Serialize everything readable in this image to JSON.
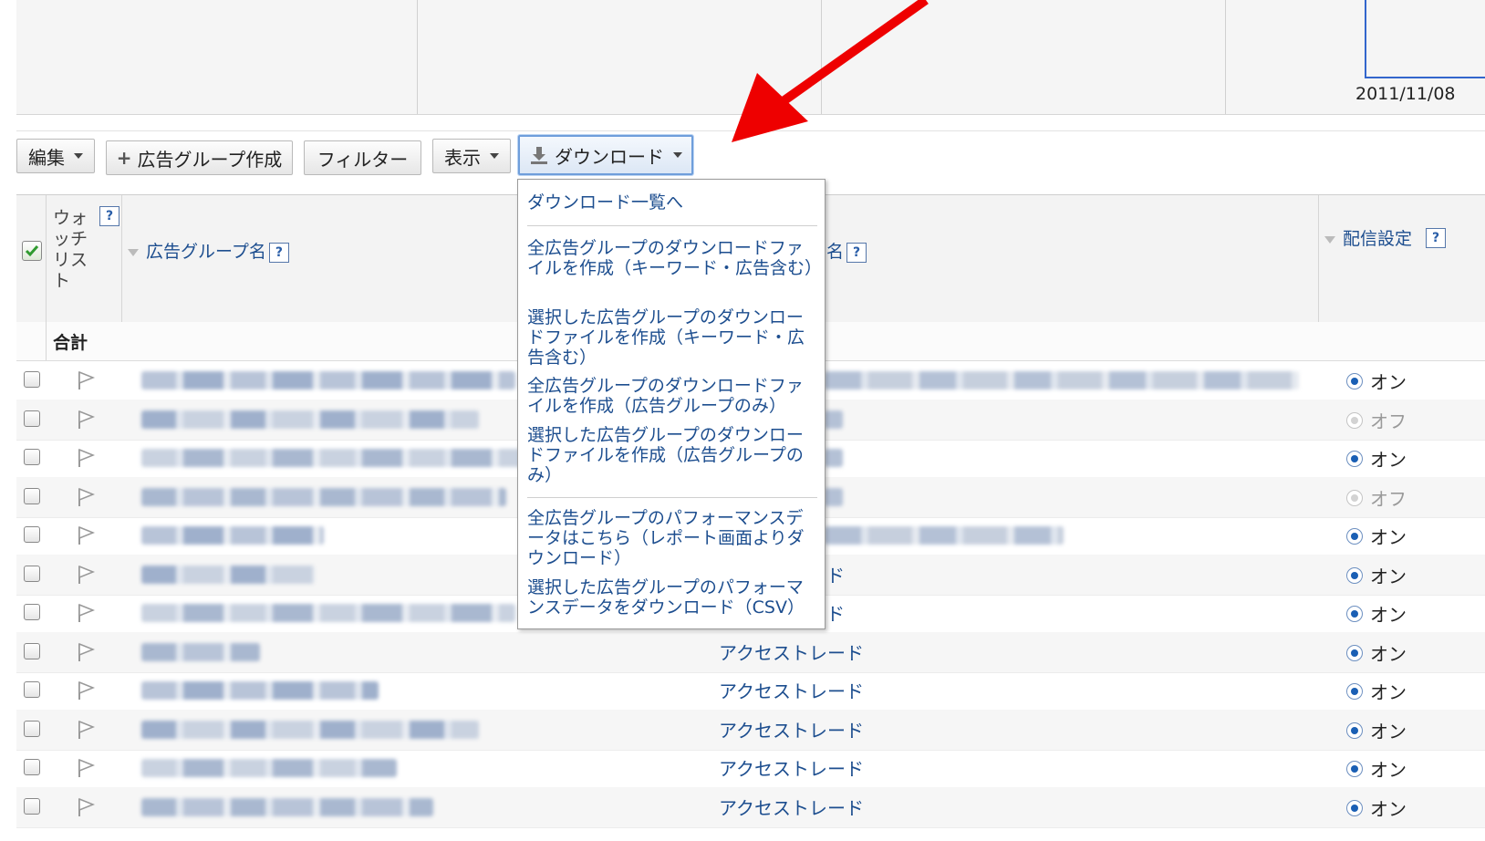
{
  "chart": {
    "date_label": "2011/11/08"
  },
  "toolbar": {
    "edit_label": "編集",
    "create_group_label": "広告グループ作成",
    "filter_label": "フィルター",
    "display_label": "表示",
    "download_label": "ダウンロード"
  },
  "download_menu": {
    "items": [
      "ダウンロード一覧へ",
      "全広告グループのダウンロードファイルを作成（キーワード・広告含む）",
      "選択した広告グループのダウンロードファイルを作成（キーワード・広告含む）",
      "全広告グループのダウンロードファイルを作成（広告グループのみ）",
      "選択した広告グループのダウンロードファイルを作成（広告グループのみ）",
      "全広告グループのパフォーマンスデータはこちら（レポート画面よりダウンロード）",
      "選択した広告グループのパフォーマンスデータをダウンロード（CSV）"
    ]
  },
  "table": {
    "headers": {
      "watchlist": "ウォッチリスト",
      "ad_group_name": "広告グループ名",
      "campaign_name_suffix": "名",
      "delivery_setting": "配信設定",
      "help_mark": "?"
    },
    "total_label": "合計",
    "rows": [
      {
        "campaign": "",
        "status": "オン",
        "on": true
      },
      {
        "campaign": "",
        "status": "オフ",
        "on": false
      },
      {
        "campaign": "",
        "status": "オン",
        "on": true
      },
      {
        "campaign": "",
        "status": "オフ",
        "on": false
      },
      {
        "campaign": "",
        "status": "オン",
        "on": true
      },
      {
        "campaign": "ド",
        "status": "オン",
        "on": true
      },
      {
        "campaign": "ド",
        "status": "オン",
        "on": true
      },
      {
        "campaign": "アクセストレード",
        "status": "オン",
        "on": true
      },
      {
        "campaign": "アクセストレード",
        "status": "オン",
        "on": true
      },
      {
        "campaign": "アクセストレード",
        "status": "オン",
        "on": true
      },
      {
        "campaign": "アクセストレード",
        "status": "オン",
        "on": true
      },
      {
        "campaign": "アクセストレード",
        "status": "オン",
        "on": true
      }
    ]
  },
  "colors": {
    "link": "#1d4e8f",
    "arrow": "#ee0000",
    "accent_blue": "#3366cc"
  }
}
